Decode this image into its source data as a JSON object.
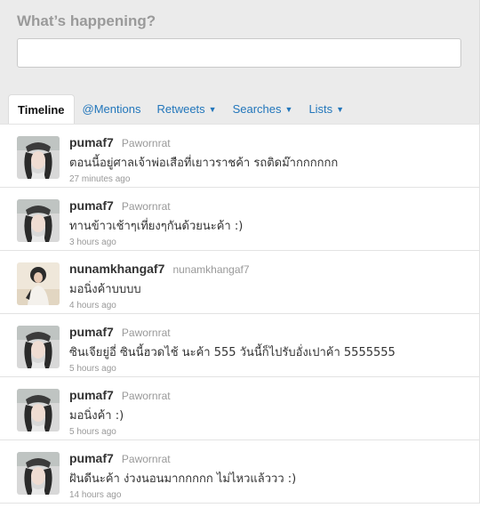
{
  "header": {
    "prompt": "What’s happening?",
    "status_value": ""
  },
  "tabs": [
    {
      "label": "Timeline"
    },
    {
      "label": "@Mentions"
    },
    {
      "label": "Retweets"
    },
    {
      "label": "Searches"
    },
    {
      "label": "Lists"
    }
  ],
  "tweets": [
    {
      "user": "pumaf7",
      "fullname": "Pawornrat",
      "text": "ตอนนี้อยู่ศาลเจ้าพ่อเสือที่เยาวราชค้า รถติดม๊ากกกกกก",
      "time": "27 minutes ago"
    },
    {
      "user": "pumaf7",
      "fullname": "Pawornrat",
      "text": "ทานข้าวเช้าๆเที่ยงๆกันด้วยนะค้า :)",
      "time": "3 hours ago"
    },
    {
      "user": "nunamkhangaf7",
      "fullname": "nunamkhangaf7",
      "text": "มอนิ่งค้าบบบบ",
      "time": "4 hours ago"
    },
    {
      "user": "pumaf7",
      "fullname": "Pawornrat",
      "text": "ซินเจียยู่อี่ ซินนี้ฮวดไช้ นะค้า 555 วันนี้ก็ไปรับอั่งเปาค้า 5555555",
      "time": "5 hours ago"
    },
    {
      "user": "pumaf7",
      "fullname": "Pawornrat",
      "text": "มอนิ่งค้า :)",
      "time": "5 hours ago"
    },
    {
      "user": "pumaf7",
      "fullname": "Pawornrat",
      "text": "ฝันดีนะค้า ง่วงนอนมากกกกก ไม่ไหวแล้ววว :)",
      "time": "14 hours ago"
    }
  ]
}
